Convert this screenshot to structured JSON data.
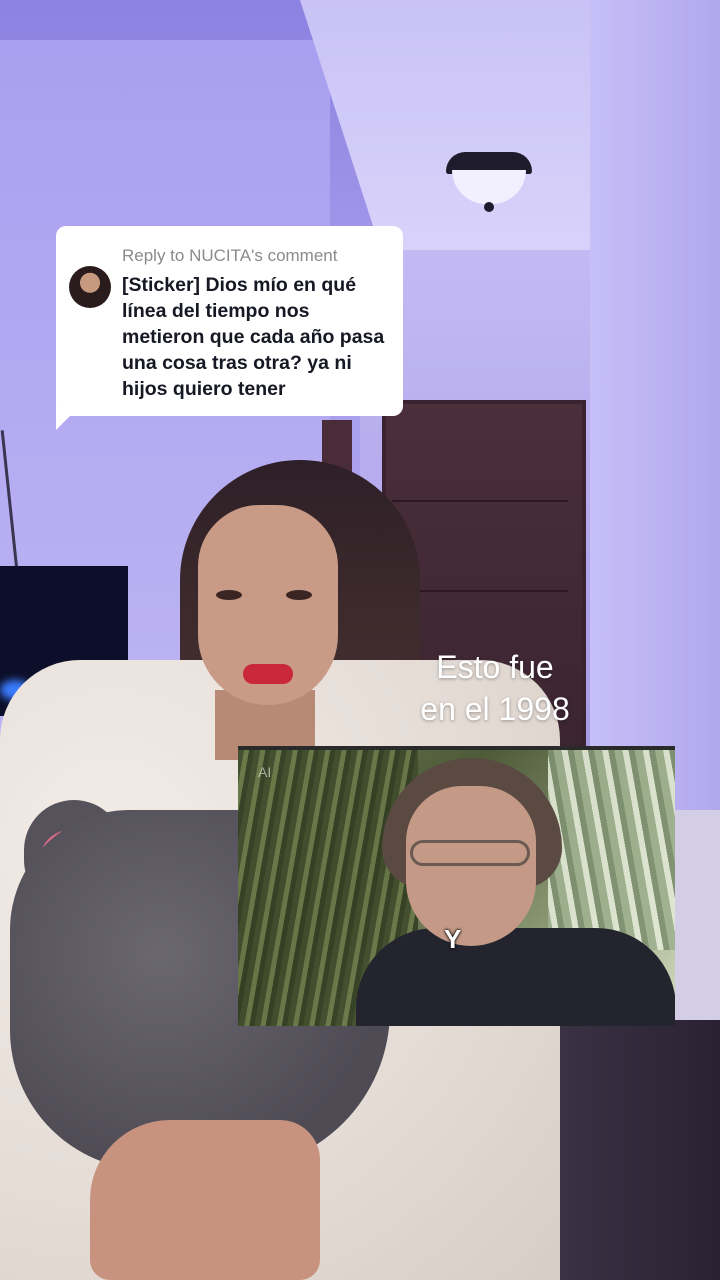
{
  "reply": {
    "header": "Reply to NUCITA's comment",
    "text": "[Sticker] Dios mío en qué línea del tiempo nos metieron que cada año pasa una cosa tras otra? ya ni hijos quiero tener"
  },
  "caption": {
    "line1": "Esto fue",
    "line2": "en el 1998"
  },
  "inset_video": {
    "watermark": "AI",
    "subtitle": "Y"
  }
}
